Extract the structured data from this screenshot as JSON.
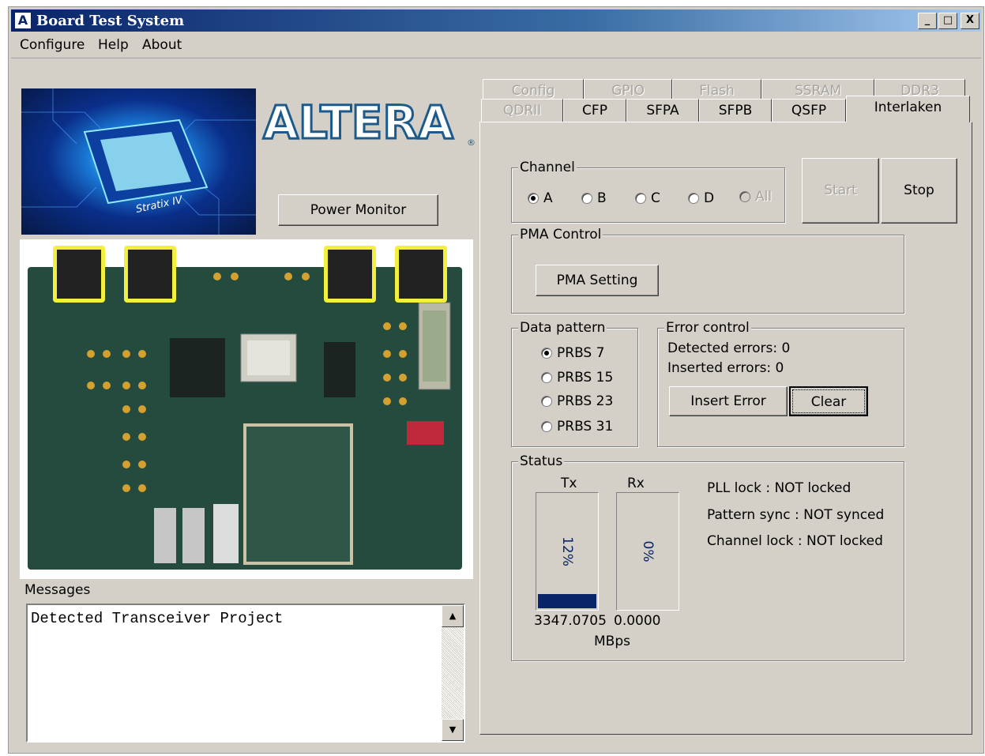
{
  "window": {
    "title": "Board Test System",
    "icon": "altera-a-icon",
    "minimize": "_",
    "maximize": "□",
    "close": "X"
  },
  "menu": [
    "Configure",
    "Help",
    "About"
  ],
  "branding": {
    "logo_text": "ALTERA",
    "registered": "®",
    "chip_label": "Stratix IV"
  },
  "power_monitor_label": "Power Monitor",
  "messages": {
    "label": "Messages",
    "text": "Detected Transceiver Project"
  },
  "tabs": {
    "back_row": [
      "Config",
      "GPIO",
      "Flash",
      "SSRAM",
      "DDR3"
    ],
    "front_row": [
      "QDRII",
      "CFP",
      "SFPA",
      "SFPB",
      "QSFP",
      "Interlaken"
    ],
    "active": "Interlaken"
  },
  "channel": {
    "label": "Channel",
    "options": [
      {
        "label": "A",
        "checked": true,
        "enabled": true
      },
      {
        "label": "B",
        "checked": false,
        "enabled": true
      },
      {
        "label": "C",
        "checked": false,
        "enabled": true
      },
      {
        "label": "D",
        "checked": false,
        "enabled": true
      },
      {
        "label": "All",
        "checked": false,
        "enabled": false
      }
    ]
  },
  "start_label": "Start",
  "stop_label": "Stop",
  "pma": {
    "label": "PMA Control",
    "button": "PMA Setting"
  },
  "data_pattern": {
    "label": "Data pattern",
    "options": [
      {
        "label": "PRBS 7",
        "checked": true
      },
      {
        "label": "PRBS 15",
        "checked": false
      },
      {
        "label": "PRBS 23",
        "checked": false
      },
      {
        "label": "PRBS 31",
        "checked": false
      }
    ]
  },
  "error_control": {
    "label": "Error control",
    "detected": "Detected errors: 0",
    "inserted": "Inserted errors: 0",
    "insert_button": "Insert Error",
    "clear_button": "Clear"
  },
  "status": {
    "label": "Status",
    "tx": {
      "label": "Tx",
      "percent_text": "12%",
      "fraction": 0.12,
      "rate": "3347.0705"
    },
    "rx": {
      "label": "Rx",
      "percent_text": "0%",
      "fraction": 0.0,
      "rate": "0.0000"
    },
    "unit": "MBps",
    "pll_lock": "PLL lock : NOT locked",
    "pattern_sync": "Pattern sync : NOT synced",
    "channel_lock": "Channel lock : NOT locked"
  },
  "colors": {
    "face": "#d4d0c8",
    "title_start": "#0a246a",
    "meter_fill": "#0a246a",
    "logo": "#1d5a8c"
  }
}
